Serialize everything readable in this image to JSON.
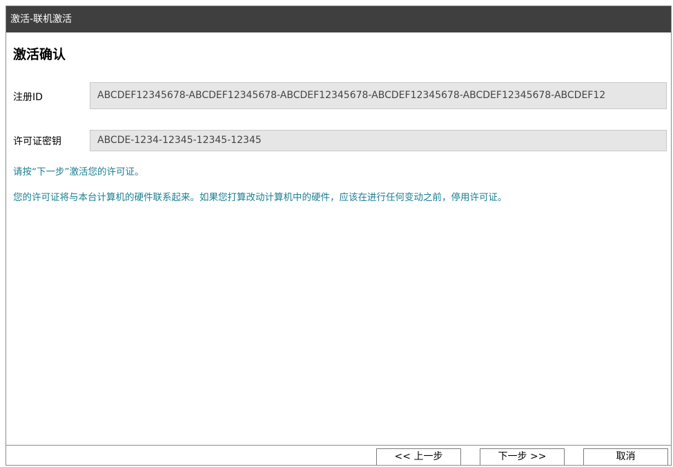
{
  "window": {
    "title": "激活-联机激活"
  },
  "page": {
    "heading": "激活确认"
  },
  "fields": {
    "registration_id": {
      "label": "注册ID",
      "value": "ABCDEF12345678-ABCDEF12345678-ABCDEF12345678-ABCDEF12345678-ABCDEF12345678-ABCDEF12"
    },
    "license_key": {
      "label": "许可证密钥",
      "value": "ABCDE-1234-12345-12345-12345"
    }
  },
  "info": {
    "line1": "请按“下一步”激活您的许可证。",
    "line2": "您的许可证将与本台计算机的硬件联系起来。如果您打算改动计算机中的硬件，应该在进行任何变动之前，停用许可证。"
  },
  "buttons": {
    "prev": "<< 上一步",
    "next": "下一步 >>",
    "cancel": "取消"
  },
  "colors": {
    "titlebar": "#3f3f3f",
    "info_text": "#1b7f93",
    "field_bg": "#e6e6e6"
  }
}
